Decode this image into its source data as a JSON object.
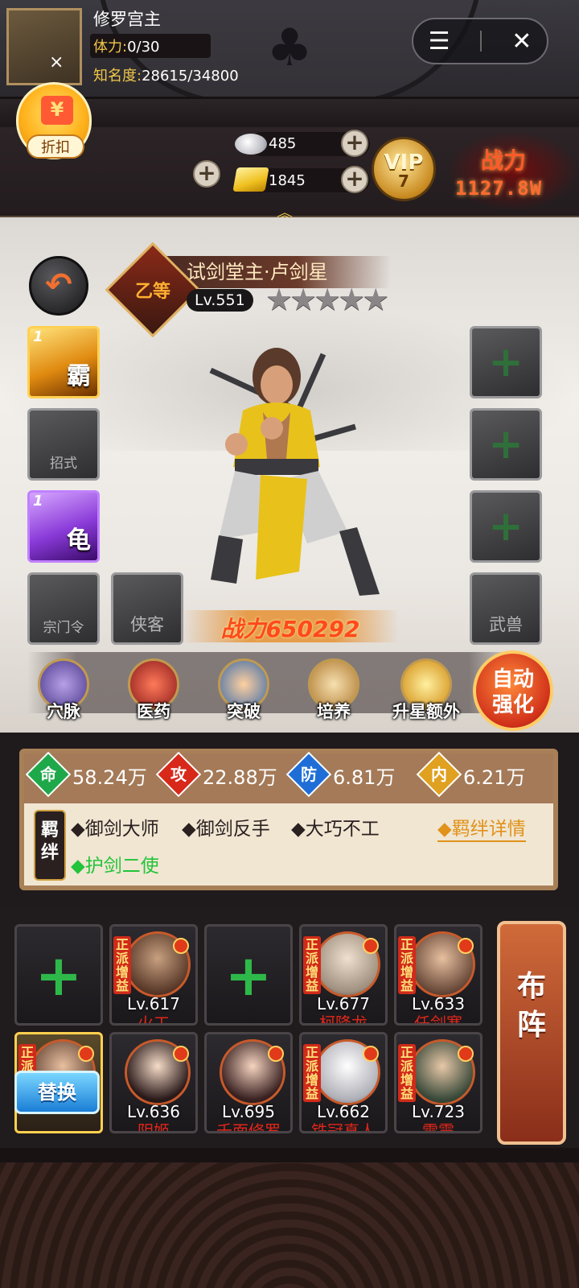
{
  "header": {
    "menu_icon": "menu-icon",
    "close_icon": "close-icon"
  },
  "player": {
    "name": "修罗宫主",
    "discount_label": "折扣",
    "stamina_label": "体力:",
    "stamina_value": "0/30",
    "fame_label": "知名度:",
    "fame_value": "28615/34800",
    "silver": "485",
    "gold": "1845",
    "vip_label": "VIP",
    "vip_level": "7",
    "combat_label": "战力",
    "combat_value": "1127.8W"
  },
  "hero": {
    "grade": "乙等",
    "name": "试剑堂主·卢剑星",
    "level": "Lv.551",
    "stars": 5,
    "power_text": "战力650292"
  },
  "slots": {
    "left": [
      {
        "level": "1",
        "glyph": "霸",
        "kind": "skill-gold"
      },
      {
        "label": "招式",
        "kind": "empty"
      },
      {
        "level": "1",
        "glyph": "龟",
        "kind": "skill-purple"
      },
      {
        "label": "宗门令",
        "kind": "empty"
      }
    ],
    "extra_label": "侠客",
    "right_plus": "+",
    "right_bottom_label": "武兽"
  },
  "functions": [
    {
      "label": "穴脉"
    },
    {
      "label": "医药"
    },
    {
      "label": "突破"
    },
    {
      "label": "培养"
    },
    {
      "label": "升星额外"
    }
  ],
  "auto_enhance": {
    "line1": "自动",
    "line2": "强化"
  },
  "stats": [
    {
      "key": "命",
      "value": "58.24万",
      "color": "#1fa84a"
    },
    {
      "key": "攻",
      "value": "22.88万",
      "color": "#d8281a"
    },
    {
      "key": "防",
      "value": "6.81万",
      "color": "#1f6ed8"
    },
    {
      "key": "内",
      "value": "6.21万",
      "color": "#e0a020"
    }
  ],
  "bonds": {
    "badge": "羁绊",
    "items": [
      "◆御剑大师",
      "◆御剑反手",
      "◆大巧不工"
    ],
    "active": "◆护剑二使",
    "detail_link": "◆羁绊详情"
  },
  "team": {
    "buff_tag": "正派增益",
    "row1": [
      {
        "empty": true
      },
      {
        "level": "Lv.617",
        "name": "火工",
        "buff": true
      },
      {
        "empty": true
      },
      {
        "level": "Lv.677",
        "name": "柯降龙",
        "buff": true
      },
      {
        "level": "Lv.633",
        "name": "任剑寒",
        "buff": true
      }
    ],
    "row2": [
      {
        "selected": true,
        "buff": true
      },
      {
        "level": "Lv.636",
        "name": "阴姬"
      },
      {
        "level": "Lv.695",
        "name": "千面修罗"
      },
      {
        "level": "Lv.662",
        "name": "铁冠真人",
        "buff": true
      },
      {
        "level": "Lv.723",
        "name": "雷震",
        "buff": true
      }
    ],
    "replace_label": "替换",
    "formation_label": "布阵",
    "plus": "+"
  }
}
